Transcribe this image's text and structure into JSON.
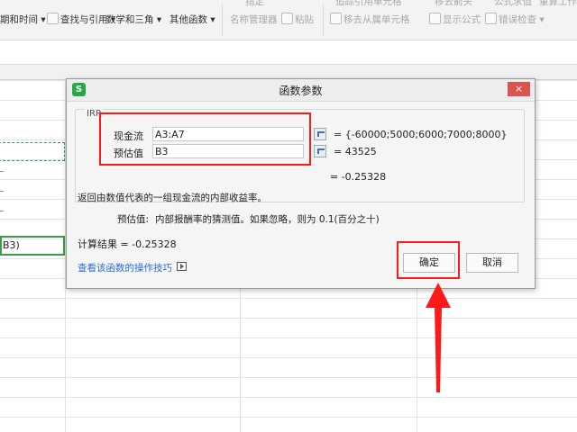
{
  "ribbon": {
    "groups": [
      "期和时间",
      "查找与引用",
      "数学和三角",
      "其他函数"
    ],
    "name_manager": "名称管理器",
    "paste": "粘贴",
    "remove_arrows": "移去从属单元格",
    "show_formula": "显示公式",
    "error_check": "错误检查",
    "cut_top1": "指定",
    "cut_top2": "追踪引用单元格",
    "cut_top3": "移去箭头",
    "cut_top4": "公式求值",
    "cut_top5": "重算工作"
  },
  "sheet": {
    "selected_cell_text": "B3)"
  },
  "dialog": {
    "app_icon": "S",
    "title": "函数参数",
    "close": "×",
    "function_name": "IRR",
    "args": [
      {
        "label": "现金流",
        "input": "A3:A7",
        "value": "= {-60000;5000;6000;7000;8000}"
      },
      {
        "label": "预估值",
        "input": "B3",
        "value": "= 43525"
      }
    ],
    "inline_result": "= -0.25328",
    "description": "返回由数值代表的一组现金流的内部收益率。",
    "arg_desc_label": "预估值:",
    "arg_desc_text": "内部报酬率的猜测值。如果忽略，则为 0.1(百分之十)",
    "calc_result": "计算结果 = -0.25328",
    "help_link": "查看该函数的操作技巧",
    "ok_label": "确定",
    "cancel_label": "取消"
  },
  "colors": {
    "highlight": "#ff1a1a",
    "accent": "#27a745",
    "link": "#2b6cd6"
  }
}
